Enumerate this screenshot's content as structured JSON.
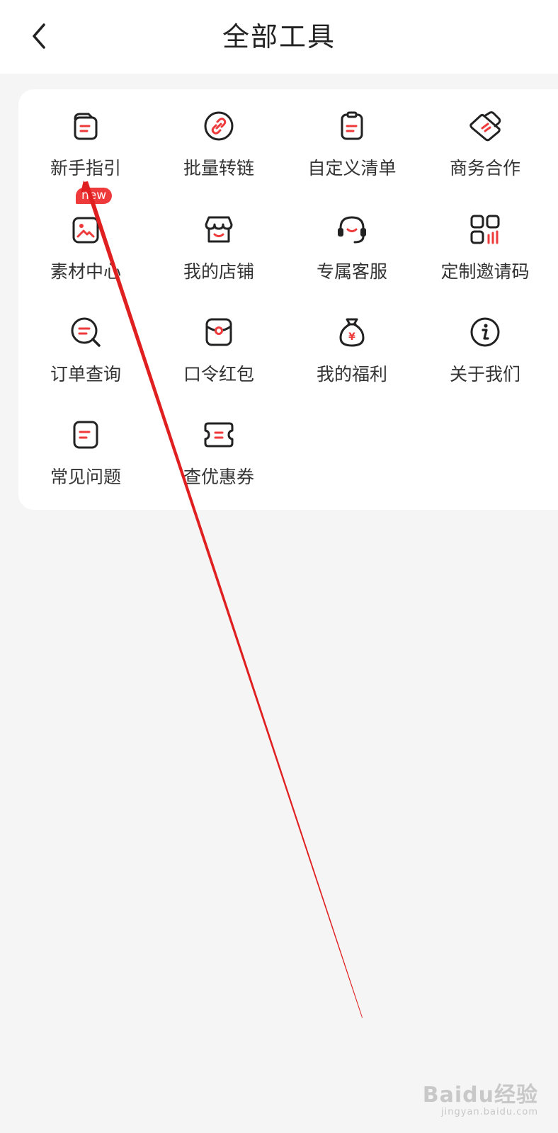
{
  "header": {
    "title": "全部工具"
  },
  "tools": [
    {
      "label": "新手指引",
      "icon": "guide-icon"
    },
    {
      "label": "批量转链",
      "icon": "link-icon"
    },
    {
      "label": "自定义清单",
      "icon": "clipboard-icon"
    },
    {
      "label": "商务合作",
      "icon": "handshake-icon"
    },
    {
      "label": "素材中心",
      "icon": "image-folder-icon",
      "badge": "new"
    },
    {
      "label": "我的店铺",
      "icon": "shop-icon"
    },
    {
      "label": "专属客服",
      "icon": "headset-icon"
    },
    {
      "label": "定制邀请码",
      "icon": "grid-chart-icon"
    },
    {
      "label": "订单查询",
      "icon": "search-list-icon"
    },
    {
      "label": "口令红包",
      "icon": "red-envelope-icon"
    },
    {
      "label": "我的福利",
      "icon": "money-bag-icon"
    },
    {
      "label": "关于我们",
      "icon": "info-icon"
    },
    {
      "label": "常见问题",
      "icon": "faq-doc-icon"
    },
    {
      "label": "查优惠券",
      "icon": "coupon-icon"
    }
  ],
  "watermark": {
    "logo": "Baidu经验",
    "url": "jingyan.baidu.com"
  },
  "colors": {
    "accent": "#ee3a3a",
    "icon_stroke": "#222222",
    "annotation_arrow": "#e02020"
  }
}
